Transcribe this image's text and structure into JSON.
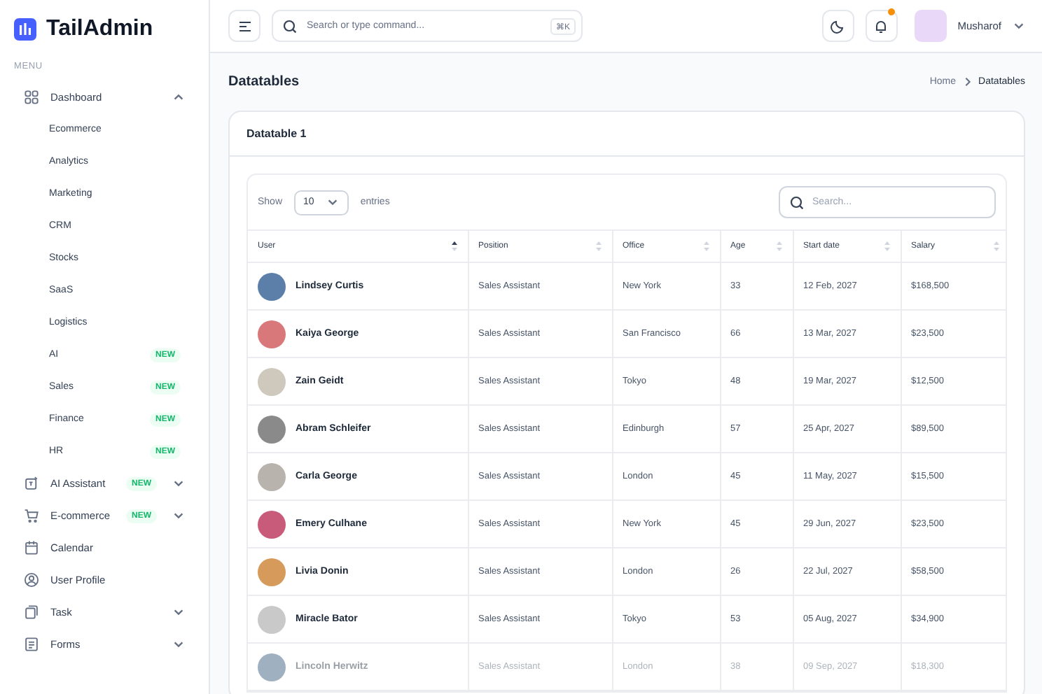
{
  "logo": {
    "text": "TailAdmin"
  },
  "sidebar": {
    "section_label": "MENU",
    "items": [
      {
        "label": "Dashboard",
        "expanded": true,
        "children": [
          {
            "label": "Ecommerce"
          },
          {
            "label": "Analytics"
          },
          {
            "label": "Marketing"
          },
          {
            "label": "CRM"
          },
          {
            "label": "Stocks"
          },
          {
            "label": "SaaS"
          },
          {
            "label": "Logistics"
          },
          {
            "label": "AI",
            "badge": "NEW"
          },
          {
            "label": "Sales",
            "badge": "NEW"
          },
          {
            "label": "Finance",
            "badge": "NEW"
          },
          {
            "label": "HR",
            "badge": "NEW"
          }
        ]
      },
      {
        "label": "AI Assistant",
        "badge": "NEW",
        "expanded": false
      },
      {
        "label": "E-commerce",
        "badge": "NEW",
        "expanded": false
      },
      {
        "label": "Calendar"
      },
      {
        "label": "User Profile"
      },
      {
        "label": "Task",
        "expanded": false
      },
      {
        "label": "Forms",
        "expanded": false
      }
    ]
  },
  "header": {
    "search_placeholder": "Search or type command...",
    "shortcut": "⌘K",
    "notification_dot": true,
    "user_name": "Musharof"
  },
  "page": {
    "title": "Datatables",
    "breadcrumb": [
      "Home",
      "Datatables"
    ]
  },
  "card": {
    "title": "Datatable 1",
    "show_label": "Show",
    "page_size": "10",
    "entries_label": "entries",
    "search_placeholder": "Search..."
  },
  "table": {
    "columns": [
      {
        "label": "User",
        "sorted": true
      },
      {
        "label": "Position",
        "sorted": false
      },
      {
        "label": "Office",
        "sorted": false
      },
      {
        "label": "Age",
        "sorted": false
      },
      {
        "label": "Start date",
        "sorted": false
      },
      {
        "label": "Salary",
        "sorted": false
      }
    ],
    "rows": [
      {
        "user": "Lindsey Curtis",
        "position": "Sales Assistant",
        "office": "New York",
        "age": "33",
        "start_date": "12 Feb, 2027",
        "salary": "$168,500",
        "color": "#5b7fa8",
        "faded": false
      },
      {
        "user": "Kaiya George",
        "position": "Sales Assistant",
        "office": "San Francisco",
        "age": "66",
        "start_date": "13 Mar, 2027",
        "salary": "$23,500",
        "color": "#d9787a",
        "faded": false
      },
      {
        "user": "Zain Geidt",
        "position": "Sales Assistant",
        "office": "Tokyo",
        "age": "48",
        "start_date": "19 Mar, 2027",
        "salary": "$12,500",
        "color": "#cfc8bd",
        "faded": false
      },
      {
        "user": "Abram Schleifer",
        "position": "Sales Assistant",
        "office": "Edinburgh",
        "age": "57",
        "start_date": "25 Apr, 2027",
        "salary": "$89,500",
        "color": "#8a8a8a",
        "faded": false
      },
      {
        "user": "Carla George",
        "position": "Sales Assistant",
        "office": "London",
        "age": "45",
        "start_date": "11 May, 2027",
        "salary": "$15,500",
        "color": "#b8b3ac",
        "faded": false
      },
      {
        "user": "Emery Culhane",
        "position": "Sales Assistant",
        "office": "New York",
        "age": "45",
        "start_date": "29 Jun, 2027",
        "salary": "$23,500",
        "color": "#c85a7a",
        "faded": false
      },
      {
        "user": "Livia Donin",
        "position": "Sales Assistant",
        "office": "London",
        "age": "26",
        "start_date": "22 Jul, 2027",
        "salary": "$58,500",
        "color": "#d69a5a",
        "faded": false
      },
      {
        "user": "Miracle Bator",
        "position": "Sales Assistant",
        "office": "Tokyo",
        "age": "53",
        "start_date": "05 Aug, 2027",
        "salary": "$34,900",
        "color": "#c9c9c9",
        "faded": false
      },
      {
        "user": "Lincoln Herwitz",
        "position": "Sales Assistant",
        "office": "London",
        "age": "38",
        "start_date": "09 Sep, 2027",
        "salary": "$18,300",
        "color": "#9fb0c0",
        "faded": true
      }
    ]
  }
}
